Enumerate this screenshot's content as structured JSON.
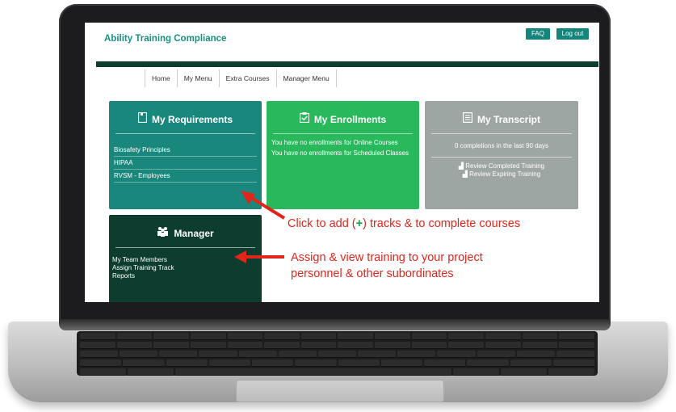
{
  "app": {
    "title": "Ability Training Compliance",
    "faq_label": "FAQ",
    "logout_label": "Log out",
    "accent_color": "#14857a",
    "dark_bar_color": "#0d3d2e"
  },
  "nav": {
    "items": [
      {
        "label": "Home"
      },
      {
        "label": "My Menu"
      },
      {
        "label": "Extra Courses"
      },
      {
        "label": "Manager Menu"
      }
    ]
  },
  "tiles": {
    "requirements": {
      "title": "My Requirements",
      "icon": "document-icon",
      "color": "#19877c",
      "items": [
        "Biosafety Principles",
        "HIPAA",
        "RVSM - Employees"
      ]
    },
    "enrollments": {
      "title": "My Enrollments",
      "icon": "clipboard-check-icon",
      "color": "#29b85c",
      "lines": [
        "You have no enrollments for Online Courses",
        "You have no enrollments for Scheduled Classes"
      ]
    },
    "transcript": {
      "title": "My Transcript",
      "icon": "list-document-icon",
      "color": "#9ea6a4",
      "summary": "0 completions in the last 90 days",
      "links": [
        "Review Completed Training",
        "Review Expiring Training"
      ]
    },
    "manager": {
      "title": "Manager",
      "icon": "team-icon",
      "color": "#0d3d2e",
      "items": [
        "My Team Members",
        "Assign Training Track",
        "Reports"
      ]
    }
  },
  "annotations": {
    "note1_prefix": "Click to add (",
    "note1_plus": "+",
    "note1_suffix": ") tracks & to complete courses",
    "note2_line1": "Assign & view training to your project",
    "note2_line2": "personnel & other subordinates",
    "color": "#e0261b"
  }
}
